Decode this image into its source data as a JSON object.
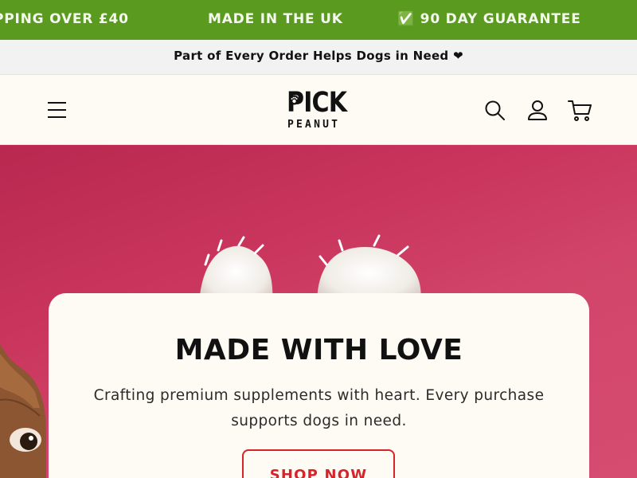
{
  "marquee": {
    "items": [
      "PPING OVER £40",
      "MADE IN THE UK",
      "✅ 90 DAY GUARANTEE"
    ]
  },
  "announcement": {
    "text": "Part of Every Order Helps Dogs in Need ❤"
  },
  "header": {
    "logo_top": "PICK",
    "logo_bottom": "PEANUT",
    "icons": [
      "menu-icon",
      "search-icon",
      "account-icon",
      "cart-icon"
    ]
  },
  "hero": {
    "title": "MADE WITH LOVE",
    "description": "Crafting premium supplements with heart. Every purchase supports dogs in need.",
    "cta_label": "SHOP NOW"
  },
  "colors": {
    "marquee_bg": "#5a9b1f",
    "hero_bg": "#c9355d",
    "cta_accent": "#d8232a",
    "card_bg": "#fdfbf3"
  }
}
